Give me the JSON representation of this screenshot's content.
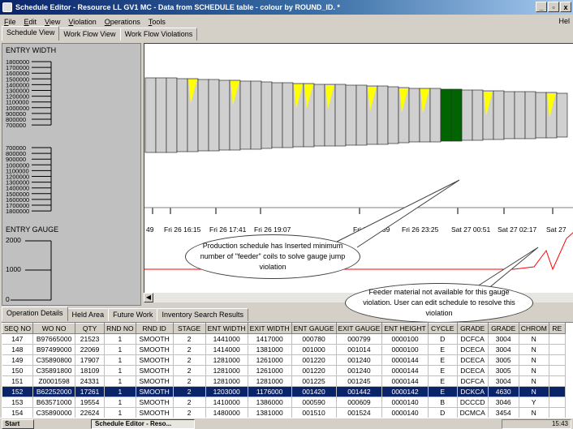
{
  "window": {
    "title": "Schedule Editor - Resource LL GV1 MC - Data from SCHEDULE table - colour by ROUND_ID. *",
    "min": "_",
    "max": "▫",
    "close": "x"
  },
  "menu": {
    "items": [
      "File",
      "Edit",
      "View",
      "Violation",
      "Operations",
      "Tools"
    ],
    "help": "Hel"
  },
  "tabs": [
    "Schedule View",
    "Work Flow View",
    "Work Flow Violations"
  ],
  "left_panel": {
    "entry_width_label": "ENTRY WIDTH",
    "width_ticks_top": [
      "1800000",
      "1700000",
      "1600000",
      "1500000",
      "1400000",
      "1300000",
      "1200000",
      "1100000",
      "1000000",
      "900000",
      "800000",
      "700000"
    ],
    "width_ticks_bottom": [
      "700000",
      "800000",
      "900000",
      "1000000",
      "1100000",
      "1200000",
      "1300000",
      "1400000",
      "1500000",
      "1600000",
      "1700000",
      "1800000"
    ],
    "entry_gauge_label": "ENTRY GAUGE",
    "gauge_ticks": [
      "2000",
      "1000",
      "0"
    ]
  },
  "timeline": [
    "49",
    "Fri 26 16:15",
    "Fri 26 17:41",
    "Fri 26 19:07",
    "Fri 26 21:59",
    "Fri 26 23:25",
    "Sat 27 00:51",
    "Sat 27 02:17",
    "Sat 27"
  ],
  "callouts": {
    "first": "Production schedule has Inserted minimum number of \"feeder\"      coils to solve gauge jump violation",
    "second": "Feeder material not available for this gauge violation. User can edit schedule to resolve this violation"
  },
  "bottom_tabs": [
    "Operation Details",
    "Held Area",
    "Future Work",
    "Inventory Search Results"
  ],
  "table": {
    "headers": [
      "SEQ NO",
      "WO NO",
      "QTY",
      "RND NO",
      "RND ID",
      "STAGE",
      "ENT WIDTH",
      "EXIT WIDTH",
      "ENT GAUGE",
      "EXIT GAUGE",
      "ENT HEIGHT",
      "CYCLE",
      "GRADE",
      "GRADE",
      "CHROM",
      "RE"
    ],
    "rows": [
      [
        "147",
        "B97665000",
        "21523",
        "1",
        "SMOOTH",
        "2",
        "1441000",
        "1417000",
        "000780",
        "000799",
        "0000100",
        "D",
        "DCFCA",
        "3004",
        "N",
        ""
      ],
      [
        "148",
        "B97499000",
        "22069",
        "1",
        "SMOOTH",
        "2",
        "1414000",
        "1381000",
        "001000",
        "001014",
        "0000100",
        "E",
        "DCECA",
        "3004",
        "N",
        ""
      ],
      [
        "149",
        "C35890800",
        "17907",
        "1",
        "SMOOTH",
        "2",
        "1281000",
        "1261000",
        "001220",
        "001240",
        "0000144",
        "E",
        "DCECA",
        "3005",
        "N",
        ""
      ],
      [
        "150",
        "C35891800",
        "18109",
        "1",
        "SMOOTH",
        "2",
        "1281000",
        "1261000",
        "001220",
        "001240",
        "0000144",
        "E",
        "DCECA",
        "3005",
        "N",
        ""
      ],
      [
        "151",
        "Z0001598",
        "24331",
        "1",
        "SMOOTH",
        "2",
        "1281000",
        "1281000",
        "001225",
        "001245",
        "0000144",
        "E",
        "DCFCA",
        "3004",
        "N",
        ""
      ],
      [
        "152",
        "B62252000",
        "17261",
        "1",
        "SMOOTH",
        "2",
        "1203000",
        "1176000",
        "001420",
        "001442",
        "0000142",
        "E",
        "DCKCA",
        "4630",
        "N",
        ""
      ],
      [
        "153",
        "B63571000",
        "19554",
        "1",
        "SMOOTH",
        "2",
        "1410000",
        "1386000",
        "000590",
        "000609",
        "0000140",
        "B",
        "DCCCD",
        "3046",
        "Y",
        ""
      ],
      [
        "154",
        "C35890000",
        "22624",
        "1",
        "SMOOTH",
        "2",
        "1480000",
        "1381000",
        "001510",
        "001524",
        "0000140",
        "D",
        "DCMCA",
        "3454",
        "N",
        ""
      ]
    ],
    "selected_row": 5
  },
  "taskbar": {
    "start": "Start",
    "app": "Schedule Editor - Reso...",
    "clock": "15:43"
  },
  "colors": {
    "titlebar": "#0a246a",
    "coil_fill": "#d0d0d0",
    "feeder": "#006400",
    "highlight": "#ffff00",
    "gauge_line": "#ff0000",
    "selection": "#0a246a"
  }
}
